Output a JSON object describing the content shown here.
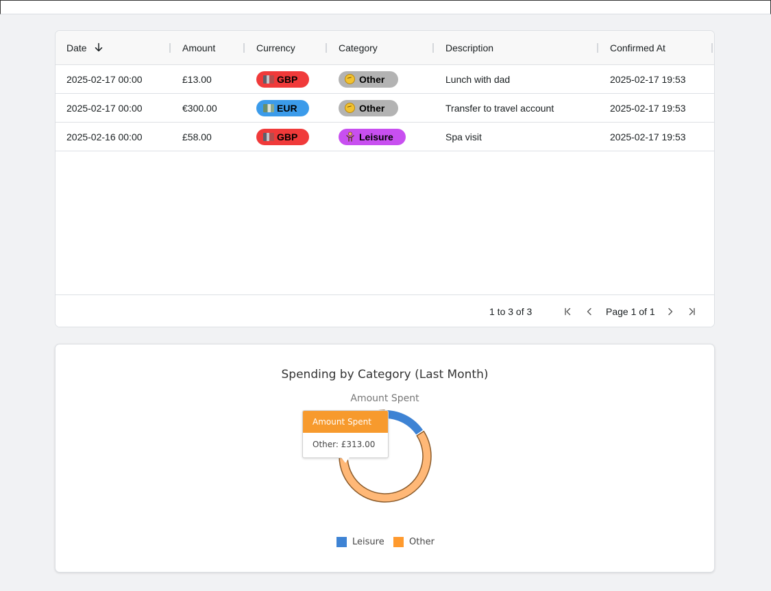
{
  "table": {
    "columns": {
      "date": "Date",
      "amount": "Amount",
      "currency": "Currency",
      "category": "Category",
      "description": "Description",
      "confirmed_at": "Confirmed At"
    },
    "sort": {
      "column": "Date",
      "direction": "descending"
    },
    "rows": [
      {
        "date": "2025-02-17 00:00",
        "amount": "£13.00",
        "currency": "GBP",
        "currency_icon": "uk-flag-icon",
        "currency_color": "#f03a3a",
        "category": "Other",
        "category_icon": "face-emoji-icon",
        "category_color": "#b3b3b3",
        "description": "Lunch with dad",
        "confirmed_at": "2025-02-17 19:53"
      },
      {
        "date": "2025-02-17 00:00",
        "amount": "€300.00",
        "currency": "EUR",
        "currency_icon": "eu-flag-icon",
        "currency_color": "#3b9bea",
        "category": "Other",
        "category_icon": "face-emoji-icon",
        "category_color": "#b3b3b3",
        "description": "Transfer to travel account",
        "confirmed_at": "2025-02-17 19:53"
      },
      {
        "date": "2025-02-16 00:00",
        "amount": "£58.00",
        "currency": "GBP",
        "currency_icon": "uk-flag-icon",
        "currency_color": "#f03a3a",
        "category": "Leisure",
        "category_icon": "person-emoji-icon",
        "category_color": "#c84ff0",
        "description": "Spa visit",
        "confirmed_at": "2025-02-17 19:53"
      }
    ],
    "pagination": {
      "summary": "1 to 3 of 3",
      "page_label": "Page 1 of 1",
      "first_icon": "first-page-icon",
      "prev_icon": "previous-page-icon",
      "next_icon": "next-page-icon",
      "last_icon": "last-page-icon"
    }
  },
  "chart": {
    "tooltip": {
      "title": "Amount Spent",
      "text": "Other: £313.00"
    }
  },
  "chart_data": {
    "type": "pie",
    "variant": "doughnut",
    "title": "Spending by Category (Last Month)",
    "subtitle": "Amount Spent",
    "categories": [
      "Leisure",
      "Other"
    ],
    "values": [
      58,
      313
    ],
    "colors": [
      "#3e83d4",
      "#ffb877"
    ],
    "legend_colors": [
      "#3e83d4",
      "#ff9a2e"
    ],
    "legend_position": "bottom"
  }
}
